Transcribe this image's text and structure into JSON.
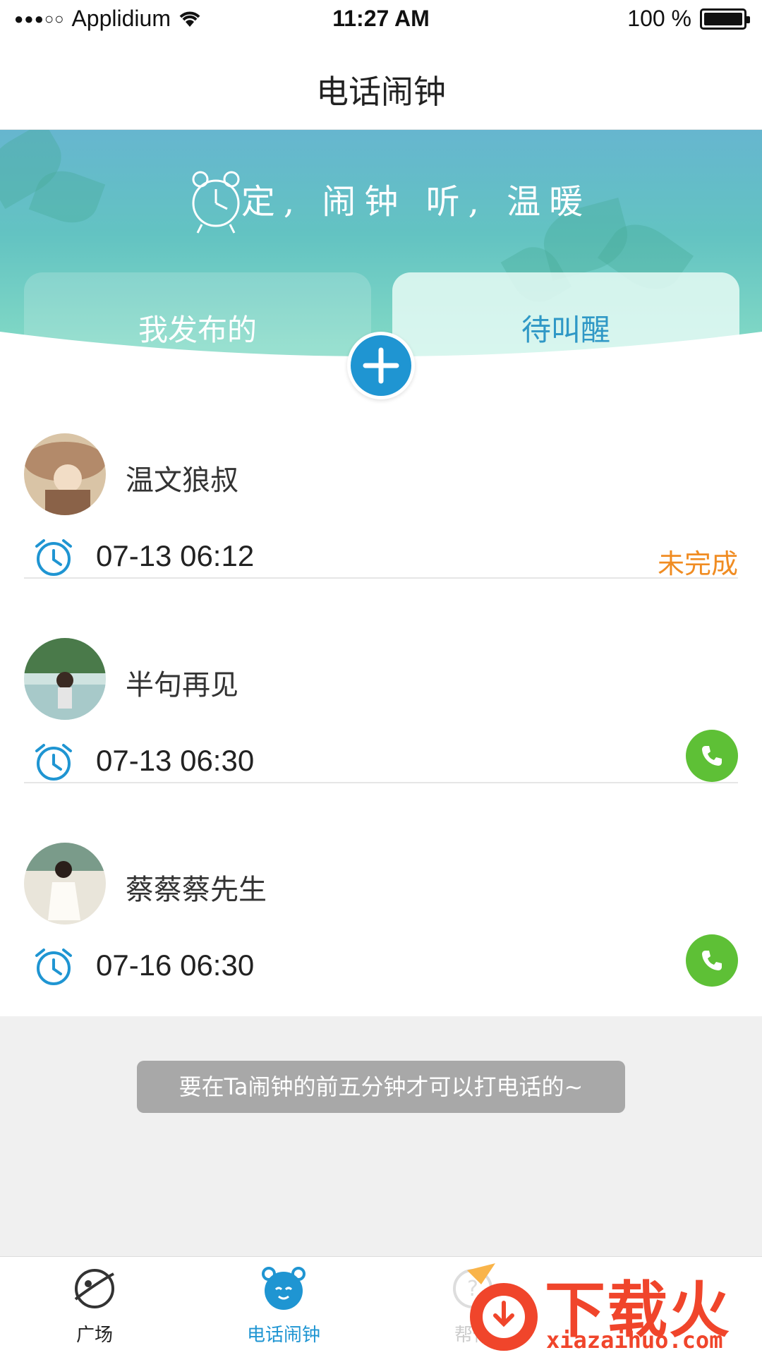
{
  "status_bar": {
    "carrier": "Applidium",
    "time": "11:27 AM",
    "battery": "100 %"
  },
  "nav": {
    "title": "电话闹钟"
  },
  "banner": {
    "slogan": "定, 闹钟 听, 温暖",
    "tabs": [
      {
        "label": "我发布的",
        "selected": false
      },
      {
        "label": "待叫醒",
        "selected": true
      }
    ]
  },
  "items": [
    {
      "name": "温文狼叔",
      "time": "07-13 06:12",
      "status": "未完成",
      "avatar_colors": [
        "#b38a6a",
        "#e8d3b0"
      ]
    },
    {
      "name": "半句再见",
      "time": "07-13 06:30",
      "status": "",
      "avatar_colors": [
        "#4a7a4a",
        "#a7c9c9"
      ]
    },
    {
      "name": "蔡蔡蔡先生",
      "time": "07-16 06:30",
      "status": "",
      "avatar_colors": [
        "#7a9b8a",
        "#e9e5da"
      ]
    }
  ],
  "toast": "要在Ta闹钟的前五分钟才可以打电话的~",
  "tab_bar": {
    "items": [
      {
        "label": "广场",
        "icon": "planet-icon"
      },
      {
        "label": "电话闹钟",
        "icon": "alarm-face-icon",
        "active": true
      },
      {
        "label": "帮忙",
        "icon": "help-icon"
      }
    ]
  },
  "watermark": {
    "brand": "下载火",
    "domain": "xiazaihuo.com"
  },
  "colors": {
    "accent": "#1f95d2",
    "status_pending": "#f08c22",
    "call_green": "#5ec036",
    "watermark": "#f0452b"
  }
}
